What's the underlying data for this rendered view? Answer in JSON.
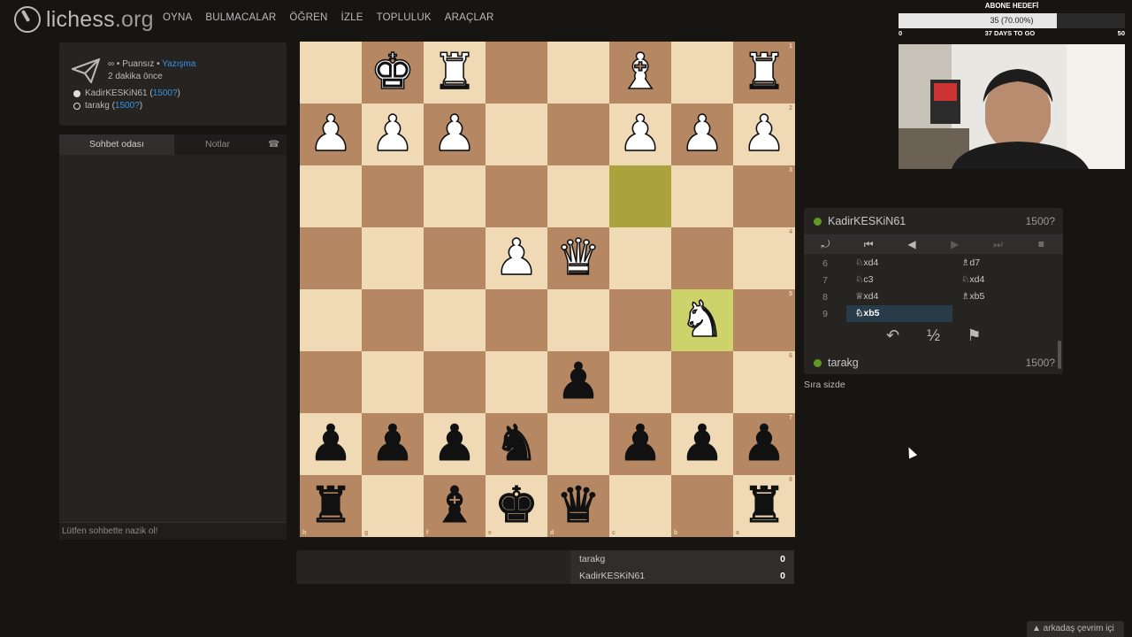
{
  "logo": {
    "name": "lichess",
    "tld": ".org"
  },
  "nav": [
    "OYNA",
    "BULMACALAR",
    "ÖĞREN",
    "İZLE",
    "TOPLULUK",
    "ARAÇLAR"
  ],
  "goal": {
    "title": "ABONE HEDEFİ",
    "progress_text": "35 (70.00%)",
    "progress": 0.7,
    "min": "0",
    "max": "50",
    "days_left": "37 DAYS TO GO"
  },
  "game_info": {
    "speed": "∞",
    "sep1": " • ",
    "rated": "Puansız",
    "sep2": " • ",
    "mode": "Yazışma",
    "time_ago": "2 dakika önce",
    "players": [
      {
        "name": "KadirKESKiN61",
        "rating": "1500?",
        "color": "white"
      },
      {
        "name": "tarakg",
        "rating": "1500?",
        "color": "black"
      }
    ]
  },
  "chat": {
    "tab_chat": "Sohbet odası",
    "tab_notes": "Notlar",
    "phone_icon": "phone-icon",
    "placeholder": "Lütfen sohbette nazik ol!"
  },
  "board": {
    "ranks": [
      "1",
      "2",
      "3",
      "4",
      "5",
      "6",
      "7",
      "8"
    ],
    "files": [
      "h",
      "g",
      "f",
      "e",
      "d",
      "c",
      "b",
      "a"
    ],
    "rows": [
      [
        "",
        "wK",
        "wR",
        "",
        "",
        "wB",
        "",
        "wR"
      ],
      [
        "wP",
        "wP",
        "wP",
        "",
        "",
        "wP",
        "wP",
        "wP"
      ],
      [
        "",
        "",
        "",
        "",
        "",
        "",
        "",
        ""
      ],
      [
        "",
        "",
        "",
        "wP",
        "wQ",
        "",
        "",
        ""
      ],
      [
        "",
        "",
        "",
        "",
        "",
        "",
        "wN",
        ""
      ],
      [
        "",
        "",
        "",
        "",
        "bP",
        "",
        "",
        ""
      ],
      [
        "bP",
        "bP",
        "bP",
        "bN",
        "",
        "bP",
        "bP",
        "bP"
      ],
      [
        "bR",
        "",
        "bB",
        "bK",
        "bQ",
        "",
        "",
        "bR"
      ]
    ],
    "highlight": [
      "c3",
      "b5"
    ]
  },
  "opponent": {
    "name": "KadirKESKiN61",
    "rating": "1500?"
  },
  "me": {
    "name": "tarakg",
    "rating": "1500?"
  },
  "controls": [
    "⤾",
    "⏮",
    "◀",
    "▶",
    "⏭",
    "≡"
  ],
  "moves": [
    {
      "n": "6",
      "w": "♘xd4",
      "b": "♗d7"
    },
    {
      "n": "7",
      "w": "♘c3",
      "b": "♘xd4"
    },
    {
      "n": "8",
      "w": "♕xd4",
      "b": "♗xb5"
    },
    {
      "n": "9",
      "w": "♘xb5",
      "b": ""
    }
  ],
  "actions": {
    "takeback": "↶",
    "draw": "½",
    "resign": "⚑"
  },
  "turn_text": "Sıra sizde",
  "score": [
    {
      "name": "tarakg",
      "points": "0"
    },
    {
      "name": "KadirKESKiN61",
      "points": "0"
    }
  ],
  "friends": "▲ arkadaş çevrim içi"
}
